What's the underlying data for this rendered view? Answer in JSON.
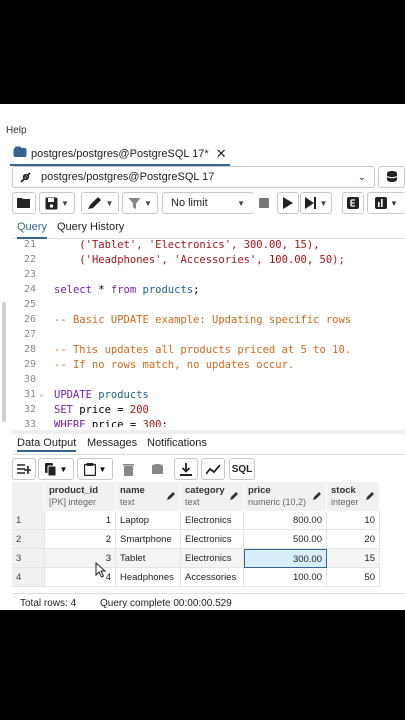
{
  "menu": {
    "help": "Help"
  },
  "tab": {
    "title": "postgres/postgres@PostgreSQL 17*",
    "close": "✕"
  },
  "connection": {
    "label": "postgres/postgres@PostgreSQL 17"
  },
  "toolbar": {
    "limit": "No limit"
  },
  "query_tabs": [
    "Query",
    "Query History"
  ],
  "editor": {
    "lines": [
      {
        "num": "21",
        "fold": ""
      },
      {
        "num": "22",
        "fold": ""
      },
      {
        "num": "23",
        "fold": ""
      },
      {
        "num": "24",
        "fold": ""
      },
      {
        "num": "25",
        "fold": ""
      },
      {
        "num": "26",
        "fold": ""
      },
      {
        "num": "27",
        "fold": ""
      },
      {
        "num": "28",
        "fold": ""
      },
      {
        "num": "29",
        "fold": ""
      },
      {
        "num": "30",
        "fold": ""
      },
      {
        "num": "31",
        "fold": "⌄"
      },
      {
        "num": "32",
        "fold": ""
      },
      {
        "num": "33",
        "fold": ""
      }
    ],
    "code": {
      "l21": "('Tablet', 'Electronics', 300.00, 15),",
      "l22": "('Headphones', 'Accessories', 100.00, 50);",
      "l24_kw1": "select",
      "l24_mid": " * ",
      "l24_kw2": "from",
      "l24_id": " products",
      "l24_end": ";",
      "l26": "-- Basic UPDATE example: Updating specific rows",
      "l28": "-- This updates all products priced at 5 to 10.",
      "l29": "-- If no rows match, no updates occur.",
      "l31_kw": "UPDATE",
      "l31_id": " products",
      "l32_kw": "SET",
      "l32_rest": " price = ",
      "l32_num": "200",
      "l33_kw": "WHERE",
      "l33_rest": " price = ",
      "l33_num": "300",
      "l33_end": ";"
    }
  },
  "output_tabs": [
    "Data Output",
    "Messages",
    "Notifications"
  ],
  "output_toolbar": {
    "sql": "SQL"
  },
  "grid": {
    "columns": [
      {
        "name": "product_id",
        "type": "[PK] integer"
      },
      {
        "name": "name",
        "type": "text"
      },
      {
        "name": "category",
        "type": "text"
      },
      {
        "name": "price",
        "type": "numeric (10,2)"
      },
      {
        "name": "stock",
        "type": "integer"
      }
    ],
    "rows": [
      [
        "1",
        "1",
        "Laptop",
        "Electronics",
        "800.00",
        "10"
      ],
      [
        "2",
        "2",
        "Smartphone",
        "Electronics",
        "500.00",
        "20"
      ],
      [
        "3",
        "3",
        "Tablet",
        "Electronics",
        "300.00",
        "15"
      ],
      [
        "4",
        "4",
        "Headphones",
        "Accessories",
        "100.00",
        "50"
      ]
    ]
  },
  "status": {
    "total_rows": "Total rows: 4",
    "query_complete": "Query complete 00:00:00.529"
  },
  "colors": {
    "accent": "#326690",
    "selected_cell": "#d8eefb"
  }
}
